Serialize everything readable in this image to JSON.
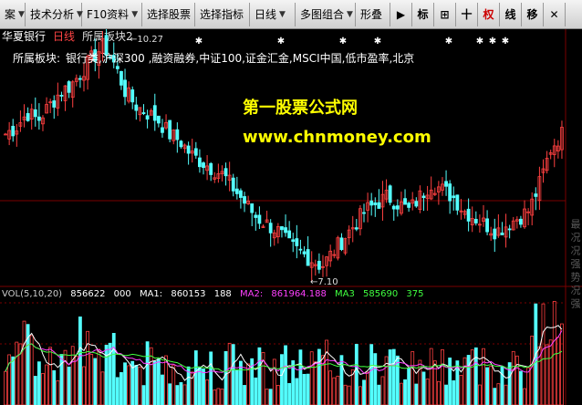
{
  "toolbar": {
    "items": [
      {
        "label": "案",
        "has_caret": true
      },
      {
        "label": "技术分析",
        "has_caret": true
      },
      {
        "label": "F10资料",
        "has_caret": true
      },
      {
        "label": "选择股票",
        "has_caret": false
      },
      {
        "label": "选择指标",
        "has_caret": false
      },
      {
        "label": "日线",
        "has_caret": true
      },
      {
        "label": "多图组合",
        "has_caret": true
      },
      {
        "label": "形叠",
        "has_caret": false
      }
    ],
    "buttons": [
      {
        "label": "▶",
        "name": "play-button"
      },
      {
        "label": "标",
        "name": "mark-button"
      },
      {
        "label": "⊞",
        "name": "grid-button"
      },
      {
        "label": "十",
        "name": "crosshair-button"
      },
      {
        "label": "权",
        "name": "rights-button",
        "active": true
      },
      {
        "label": "线",
        "name": "line-button"
      },
      {
        "label": "移",
        "name": "move-button"
      },
      {
        "label": "✕",
        "name": "close-button"
      }
    ]
  },
  "info": {
    "stock": "华夏银行",
    "period": "日线",
    "mode": "所属板块2"
  },
  "sector": {
    "label": "所属板块:",
    "value": "银行类,沪深300 ,融资融券,中证100,证金汇金,MSCI中国,低市盈率,北京"
  },
  "watermark": {
    "line1": "第一股票公式网",
    "line2": "www.chnmoney.com"
  },
  "annotations": {
    "high": "10.27",
    "low": "7.10"
  },
  "volume": {
    "label": "VOL(5,10,20)",
    "value": "856622",
    "value2": "000",
    "ma1_label": "MA1:",
    "ma1": "860153",
    "ma1b": "188",
    "ma2_label": "MA2:",
    "ma2": "861964.188",
    "ma3_label": "MA3",
    "ma3": "585690",
    "ma3b": "375"
  },
  "right_label": "最 况 况 强 势 况 强",
  "colors": {
    "up": "#ff4040",
    "down": "#54ffff",
    "ma1": "#ffffff",
    "ma2": "#ff40ff",
    "ma3": "#40ff40",
    "grid": "#7a0000"
  },
  "chart_data": {
    "type": "candlestick",
    "close_path": [
      9.0,
      9.1,
      9.3,
      9.2,
      9.4,
      9.6,
      9.7,
      9.9,
      10.1,
      10.27,
      10.0,
      9.6,
      9.4,
      9.3,
      9.2,
      9.0,
      8.9,
      8.7,
      8.6,
      8.5,
      8.4,
      8.2,
      8.0,
      7.8,
      7.7,
      7.6,
      7.4,
      7.3,
      7.2,
      7.1,
      7.3,
      7.5,
      7.7,
      7.9,
      8.0,
      8.1,
      8.0,
      7.9,
      8.1,
      8.3,
      8.2,
      8.1,
      7.9,
      7.8,
      7.7,
      7.6,
      7.7,
      7.8,
      7.9,
      8.3,
      8.8,
      9.0
    ]
  }
}
